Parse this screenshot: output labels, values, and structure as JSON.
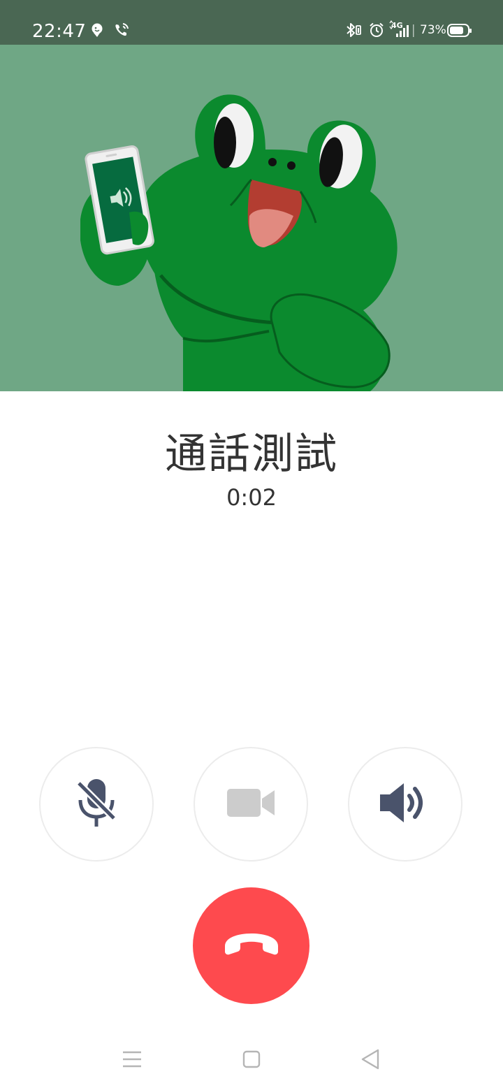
{
  "status_bar": {
    "time": "22:47",
    "battery_percent": "73%",
    "icons": [
      "notification-avatar-icon",
      "call-ongoing-icon",
      "bluetooth-icon",
      "alarm-icon",
      "signal-4g-icon",
      "battery-icon"
    ]
  },
  "hero": {
    "illustration": "green-frog-holding-phone-speaker",
    "background_color": "#6fa785"
  },
  "call": {
    "name": "通話測試",
    "duration": "0:02"
  },
  "controls": {
    "mute": {
      "icon": "microphone-muted-icon",
      "color": "#4a536b"
    },
    "video": {
      "icon": "video-camera-icon",
      "color": "#cccccc"
    },
    "speaker": {
      "icon": "speaker-icon",
      "color": "#4a536b"
    }
  },
  "end_call": {
    "icon": "phone-hangup-icon",
    "color": "#fe4a4e"
  },
  "nav_bar": {
    "icons": [
      "recent-apps-icon",
      "home-icon",
      "back-icon"
    ]
  }
}
